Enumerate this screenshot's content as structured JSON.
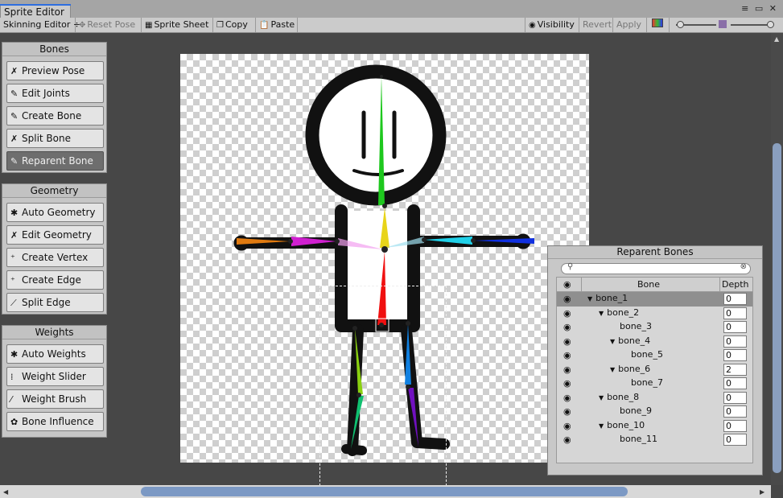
{
  "window": {
    "tab_title": "Sprite Editor",
    "controls": "≡ ▭ ✕"
  },
  "toolbar": {
    "mode_dropdown": "Skinning Editor ÷",
    "reset_pose": "Reset Pose",
    "sprite_sheet": "Sprite Sheet",
    "copy": "Copy",
    "paste": "Paste",
    "visibility": "Visibility",
    "revert": "Revert",
    "apply": "Apply"
  },
  "panels": {
    "bones": {
      "title": "Bones",
      "buttons": [
        "Preview Pose",
        "Edit Joints",
        "Create Bone",
        "Split Bone",
        "Reparent Bone"
      ],
      "active_index": 4
    },
    "geometry": {
      "title": "Geometry",
      "buttons": [
        "Auto Geometry",
        "Edit Geometry",
        "Create Vertex",
        "Create Edge",
        "Split Edge"
      ]
    },
    "weights": {
      "title": "Weights",
      "buttons": [
        "Auto Weights",
        "Weight Slider",
        "Weight Brush",
        "Bone Influence"
      ]
    }
  },
  "reparent": {
    "title": "Reparent Bones",
    "columns": {
      "bone": "Bone",
      "depth": "Depth"
    },
    "rows": [
      {
        "name": "bone_1",
        "level": 0,
        "expanded": true,
        "depth": "0",
        "selected": true
      },
      {
        "name": "bone_2",
        "level": 1,
        "expanded": true,
        "depth": "0"
      },
      {
        "name": "bone_3",
        "level": 2,
        "expanded": null,
        "depth": "0"
      },
      {
        "name": "bone_4",
        "level": 2,
        "expanded": true,
        "depth": "0"
      },
      {
        "name": "bone_5",
        "level": 3,
        "expanded": null,
        "depth": "0"
      },
      {
        "name": "bone_6",
        "level": 2,
        "expanded": true,
        "depth": "2"
      },
      {
        "name": "bone_7",
        "level": 3,
        "expanded": null,
        "depth": "0"
      },
      {
        "name": "bone_8",
        "level": 1,
        "expanded": true,
        "depth": "0"
      },
      {
        "name": "bone_9",
        "level": 2,
        "expanded": null,
        "depth": "0"
      },
      {
        "name": "bone_10",
        "level": 1,
        "expanded": true,
        "depth": "0"
      },
      {
        "name": "bone_11",
        "level": 2,
        "expanded": null,
        "depth": "0"
      }
    ]
  },
  "colors": {
    "accent_tab": "#2e6ee0",
    "scroll_thumb": "#7c99c4"
  }
}
